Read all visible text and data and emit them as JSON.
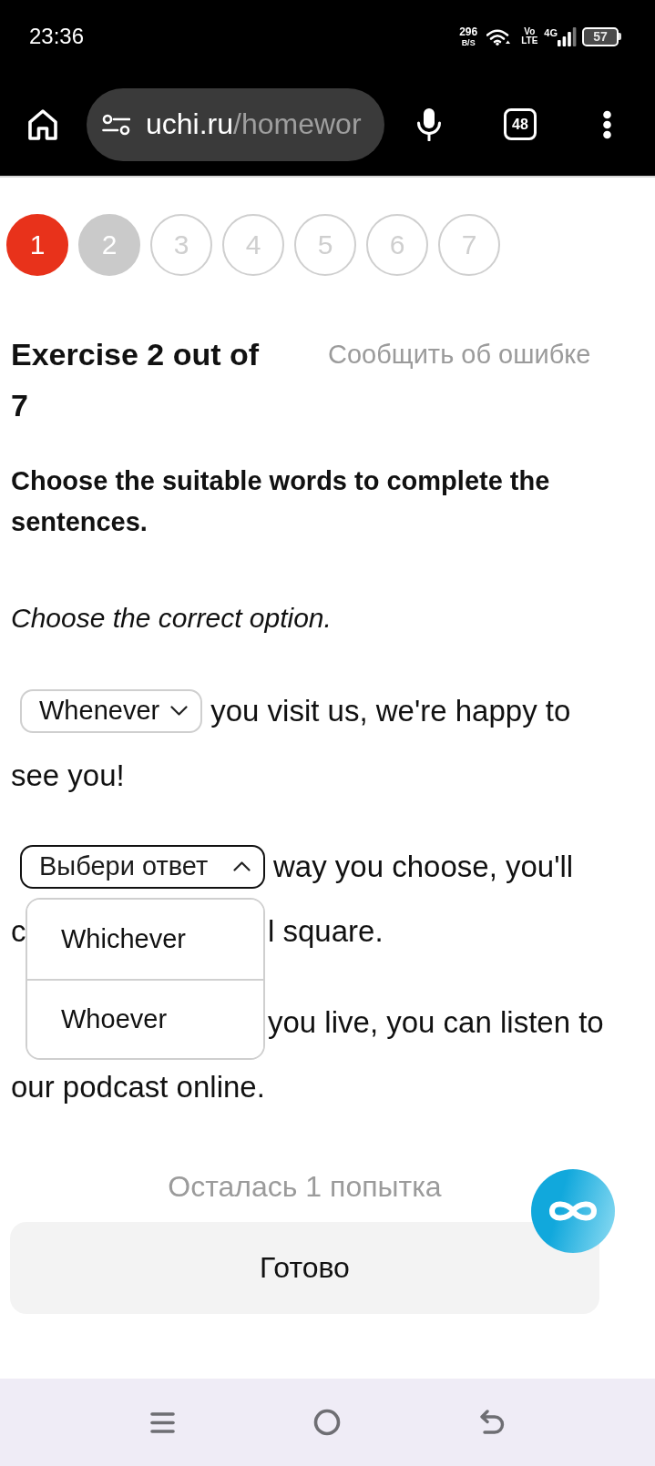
{
  "status_bar": {
    "time": "23:36",
    "net_speed": "296",
    "net_speed_unit": "B/S",
    "volte": [
      "Vo",
      "LTE"
    ],
    "network_type": "4G",
    "battery": "57"
  },
  "browser": {
    "url_host": "uchi.ru",
    "url_path": "/homewor",
    "tab_count": "48"
  },
  "steps": [
    {
      "label": "1",
      "incorrect": true,
      "selected": false
    },
    {
      "label": "2",
      "incorrect": false,
      "selected": true
    },
    {
      "label": "3",
      "incorrect": false,
      "selected": false
    },
    {
      "label": "4",
      "incorrect": false,
      "selected": false
    },
    {
      "label": "5",
      "incorrect": false,
      "selected": false
    },
    {
      "label": "6",
      "incorrect": false,
      "selected": false
    },
    {
      "label": "7",
      "incorrect": false,
      "selected": false
    }
  ],
  "exercise": {
    "title": "Exercise 2 out of 7",
    "report_link": "Сообщить об ошибке",
    "task": "Choose the suitable words to complete the sentences.",
    "instruction": "Choose the correct option.",
    "sentences": [
      {
        "dropdown": {
          "value": "Whenever",
          "expanded": false
        },
        "lines": [
          {
            "text": "you visit us, we're happy to"
          },
          {
            "text": "see you!"
          }
        ]
      },
      {
        "dropdown": {
          "placeholder": "Выбери ответ",
          "expanded": true,
          "options": [
            {
              "label": "Whichever",
              "selected": false
            },
            {
              "label": "Whoever",
              "selected": false
            }
          ]
        },
        "lines": [
          {
            "text": "way you choose, you'll"
          },
          {
            "before_popup": "c",
            "after_popup": "l square."
          }
        ]
      },
      {
        "lines": [
          {
            "after_popup": "you live, you can listen to"
          },
          {
            "text": "our podcast online."
          }
        ]
      }
    ]
  },
  "attempts": "Осталась 1 попытка",
  "submit_button": "Готово"
}
